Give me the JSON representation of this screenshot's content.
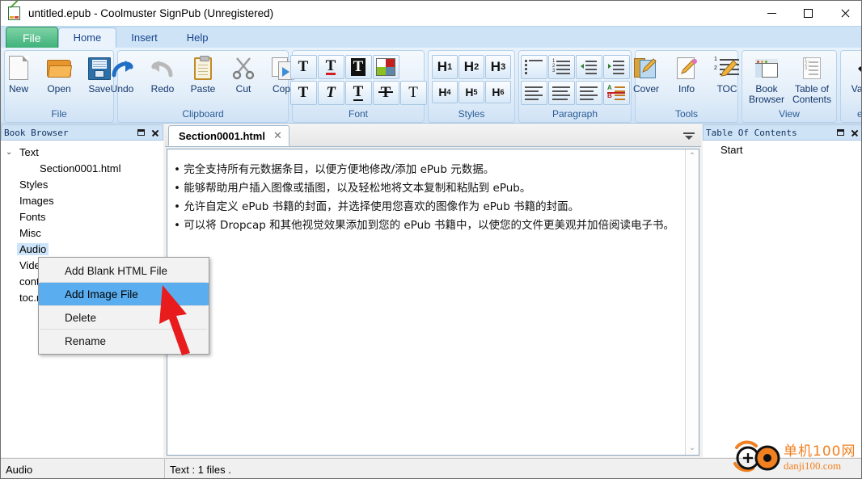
{
  "window": {
    "title": "untitled.epub - Coolmuster SignPub (Unregistered)",
    "icon": "epub-document-icon",
    "buttons": {
      "minimize": "minimize-button",
      "maximize": "maximize-button",
      "close": "close-button"
    }
  },
  "ribbon": {
    "tabs": [
      {
        "label": "File",
        "type": "file"
      },
      {
        "label": "Home",
        "type": "active"
      },
      {
        "label": "Insert",
        "type": "normal"
      },
      {
        "label": "Help",
        "type": "normal"
      }
    ],
    "groups": [
      {
        "label": "File",
        "buttons": [
          {
            "label": "New",
            "icon": "new-document-icon"
          },
          {
            "label": "Open",
            "icon": "open-folder-icon"
          },
          {
            "label": "Save",
            "icon": "save-floppy-icon"
          }
        ]
      },
      {
        "label": "Clipboard",
        "buttons": [
          {
            "label": "Undo",
            "icon": "undo-arrow-icon"
          },
          {
            "label": "Redo",
            "icon": "redo-arrow-icon"
          },
          {
            "label": "Paste",
            "icon": "clipboard-icon"
          },
          {
            "label": "Cut",
            "icon": "scissors-icon"
          },
          {
            "label": "Copy",
            "icon": "copy-pages-icon"
          }
        ]
      },
      {
        "label": "Font",
        "row1": [
          {
            "label": "T",
            "icon": "text-color-icon"
          },
          {
            "label": "T",
            "icon": "text-underline-color-icon"
          },
          {
            "label": "T",
            "icon": "text-highlight-icon"
          },
          {
            "label": "",
            "icon": "color-swatch-icon"
          }
        ],
        "row2": [
          {
            "label": "T",
            "icon": "bold-icon"
          },
          {
            "label": "T",
            "icon": "italic-icon"
          },
          {
            "label": "T",
            "icon": "underline-icon"
          },
          {
            "label": "T",
            "icon": "strikethrough-icon"
          },
          {
            "label": "T",
            "icon": "plain-text-icon"
          }
        ]
      },
      {
        "label": "Styles",
        "headings1": [
          "H1",
          "H2",
          "H3"
        ],
        "headings2": [
          "H4",
          "H5",
          "H6"
        ]
      },
      {
        "label": "Paragraph",
        "row1": [
          {
            "icon": "bullet-list-icon"
          },
          {
            "icon": "numbered-list-icon"
          },
          {
            "icon": "decrease-indent-icon"
          },
          {
            "icon": "increase-indent-icon"
          }
        ],
        "row2": [
          {
            "icon": "align-left-icon"
          },
          {
            "icon": "align-center-icon"
          },
          {
            "icon": "align-right-icon"
          },
          {
            "icon": "sort-az-icon"
          }
        ]
      },
      {
        "label": "Tools",
        "buttons": [
          {
            "label": "Cover",
            "icon": "book-cover-edit-icon"
          },
          {
            "label": "Info",
            "icon": "document-edit-icon"
          },
          {
            "label": "TOC",
            "icon": "toc-edit-icon"
          }
        ]
      },
      {
        "label": "View",
        "buttons": [
          {
            "label": "Book\nBrowser",
            "line1": "Book",
            "line2": "Browser",
            "icon": "browser-window-icon"
          },
          {
            "label": "Table of Contents",
            "line1": "Table of",
            "line2": "Contents",
            "icon": "toc-list-icon"
          }
        ]
      },
      {
        "label": "ePub",
        "buttons": [
          {
            "label": "Validate",
            "icon": "checkmark-icon"
          }
        ]
      }
    ]
  },
  "book_browser": {
    "title": "Book Browser",
    "float_button": "restore-panel-button",
    "close_button": "close-panel-button",
    "tree": [
      {
        "label": "Text",
        "level": 0,
        "expanded": true,
        "selected": false
      },
      {
        "label": "Section0001.html",
        "level": 1,
        "expanded": false,
        "selected": false
      },
      {
        "label": "Styles",
        "level": 0,
        "expanded": false,
        "selected": false
      },
      {
        "label": "Images",
        "level": 0,
        "expanded": false,
        "selected": false
      },
      {
        "label": "Fonts",
        "level": 0,
        "expanded": false,
        "selected": false
      },
      {
        "label": "Misc",
        "level": 0,
        "expanded": false,
        "selected": false
      },
      {
        "label": "Audio",
        "level": 0,
        "expanded": false,
        "selected": true
      },
      {
        "label": "Video",
        "level": 0,
        "expanded": false,
        "selected": false
      },
      {
        "label": "content.opf",
        "level": 0,
        "expanded": false,
        "selected": false
      },
      {
        "label": "toc.ncx",
        "level": 0,
        "expanded": false,
        "selected": false
      }
    ]
  },
  "context_menu": {
    "items": [
      {
        "label": "Add Blank HTML File",
        "selected": false
      },
      {
        "label": "Add Image File",
        "selected": true
      },
      {
        "label": "Delete",
        "selected": false
      },
      {
        "label": "Rename",
        "selected": false
      }
    ]
  },
  "editor": {
    "tab": {
      "label": "Section0001.html",
      "close": "close-tab-button"
    },
    "overflow_button": "tab-overflow-button",
    "lines": [
      "• 完全支持所有元数据条目，以便方便地修改/添加 ePub 元数据。",
      "• 能够帮助用户插入图像或插图，以及轻松地将文本复制和粘贴到 ePub。",
      "• 允许自定义 ePub 书籍的封面，并选择使用您喜欢的图像作为 ePub 书籍的封面。",
      "• 可以将 Dropcap 和其他视觉效果添加到您的 ePub 书籍中，以使您的文件更美观并加倍阅读电子书。"
    ],
    "scroll_up": "scroll-up-arrow",
    "scroll_down": "scroll-down-arrow"
  },
  "toc_panel": {
    "title": "Table Of Contents",
    "float_button": "restore-panel-button",
    "close_button": "close-panel-button",
    "items": [
      "Start"
    ]
  },
  "statusbar": {
    "left": "Audio",
    "right": "Text : 1 files ."
  },
  "watermark": {
    "cn": "单机100网",
    "en": "danji100.com",
    "color": "#f08020"
  },
  "colors": {
    "ribbon_blue": "#cfe3f7",
    "accent_green": "#3fb27a",
    "selection_blue": "#5aaef0",
    "tree_selection": "#cde4fa"
  }
}
